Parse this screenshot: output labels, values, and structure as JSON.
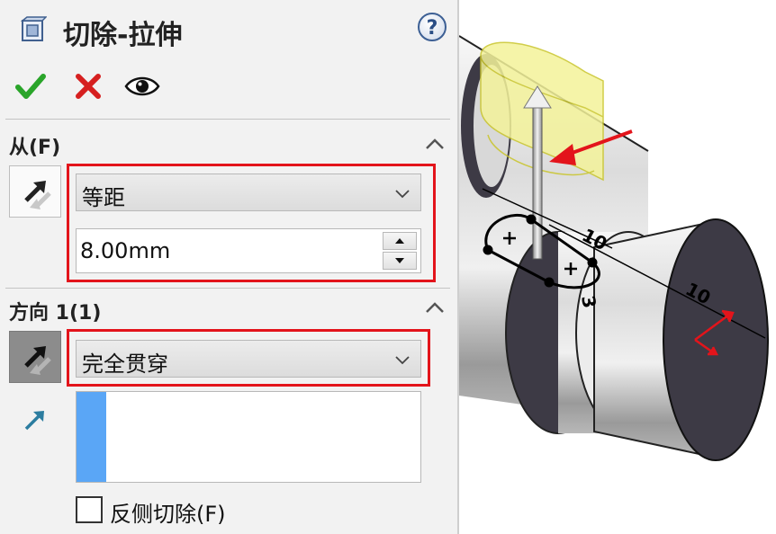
{
  "panel": {
    "title": "切除-拉伸",
    "help_glyph": "?",
    "actions": [
      "ok-check-icon",
      "cancel-x-icon",
      "preview-eye-icon"
    ],
    "from_section": {
      "title": "从(F)",
      "type_value": "等距",
      "offset_value": "8.00mm"
    },
    "direction_section": {
      "title": "方向 1(1)",
      "end_condition_value": "完全贯穿"
    },
    "flip_side_label": "反侧切除(F)"
  },
  "viewport": {
    "dimension_labels": [
      "10",
      "10",
      "3"
    ]
  },
  "colors": {
    "highlight_red": "#e3141b",
    "selection_blue": "#5aa6f6",
    "preview_yellow": "#f4f39a",
    "check_green": "#2aa52a",
    "cross_red": "#d62020"
  }
}
